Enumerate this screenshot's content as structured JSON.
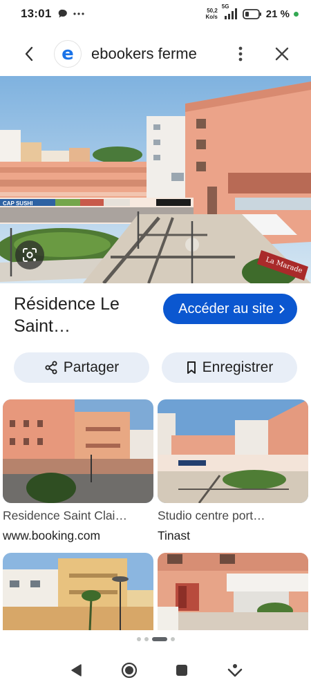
{
  "status": {
    "time": "13:01",
    "net_speed_value": "50,2",
    "net_speed_unit": "Ko/s",
    "network_type": "5G",
    "battery": "21 %",
    "icons": [
      "chat-bubble-icon",
      "more-dots-icon",
      "signal-icon",
      "battery-icon"
    ]
  },
  "header": {
    "logo_letter": "e",
    "title": "ebookers ferme",
    "icons": [
      "back-arrow-icon",
      "more-vert-icon",
      "close-icon"
    ]
  },
  "hero": {
    "sign_text_1": "CAP SUSHI",
    "sign_text_2": "La Marade",
    "icons": [
      "lens-icon"
    ]
  },
  "place": {
    "title": "Résidence Le Saint…"
  },
  "buttons": {
    "visit_label": "Accéder au site",
    "share_label": "Partager",
    "save_label": "Enregistrer"
  },
  "results": [
    {
      "title": "Residence Saint Clai…",
      "source": "www.booking.com"
    },
    {
      "title": "Studio centre port…",
      "source": "Tinast"
    }
  ],
  "colors": {
    "accent": "#0b57d0",
    "pill_bg": "#e8eef7",
    "building": "#e8a58a"
  }
}
